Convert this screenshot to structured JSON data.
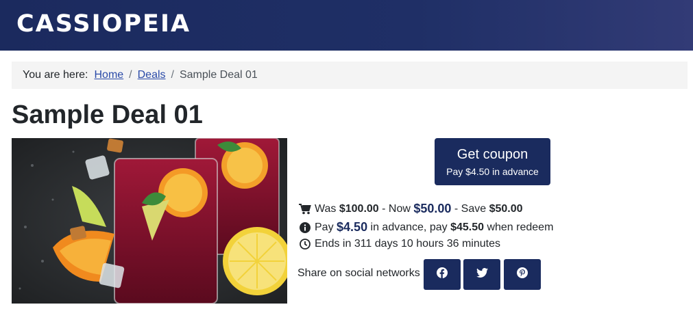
{
  "header": {
    "brand": "CASSIOPEIA"
  },
  "breadcrumb": {
    "lead": "You are here:",
    "items": [
      "Home",
      "Deals"
    ],
    "current": "Sample Deal 01",
    "separator": "/"
  },
  "page": {
    "title": "Sample Deal 01"
  },
  "coupon": {
    "label": "Get coupon",
    "sublabel": "Pay $4.50 in advance"
  },
  "price": {
    "was_label": "Was",
    "was": "$100.00",
    "now_label": "- Now",
    "now": "$50.00",
    "save_label": "- Save",
    "save": "$50.00"
  },
  "advance": {
    "pay_label": "Pay",
    "amount": "$4.50",
    "middle": "in advance, pay",
    "redeem_amount": "$45.50",
    "suffix": "when redeem"
  },
  "countdown": {
    "text": "Ends in 311 days 10 hours 36 minutes"
  },
  "share": {
    "label": "Share on social networks",
    "networks": [
      "facebook-icon",
      "twitter-icon",
      "pinterest-icon"
    ]
  },
  "icons": [
    "cart-icon",
    "info-icon",
    "clock-icon"
  ],
  "colors": {
    "header": "#1b2a5e",
    "accent": "#1a2b5e",
    "link": "#2a4aa8"
  }
}
